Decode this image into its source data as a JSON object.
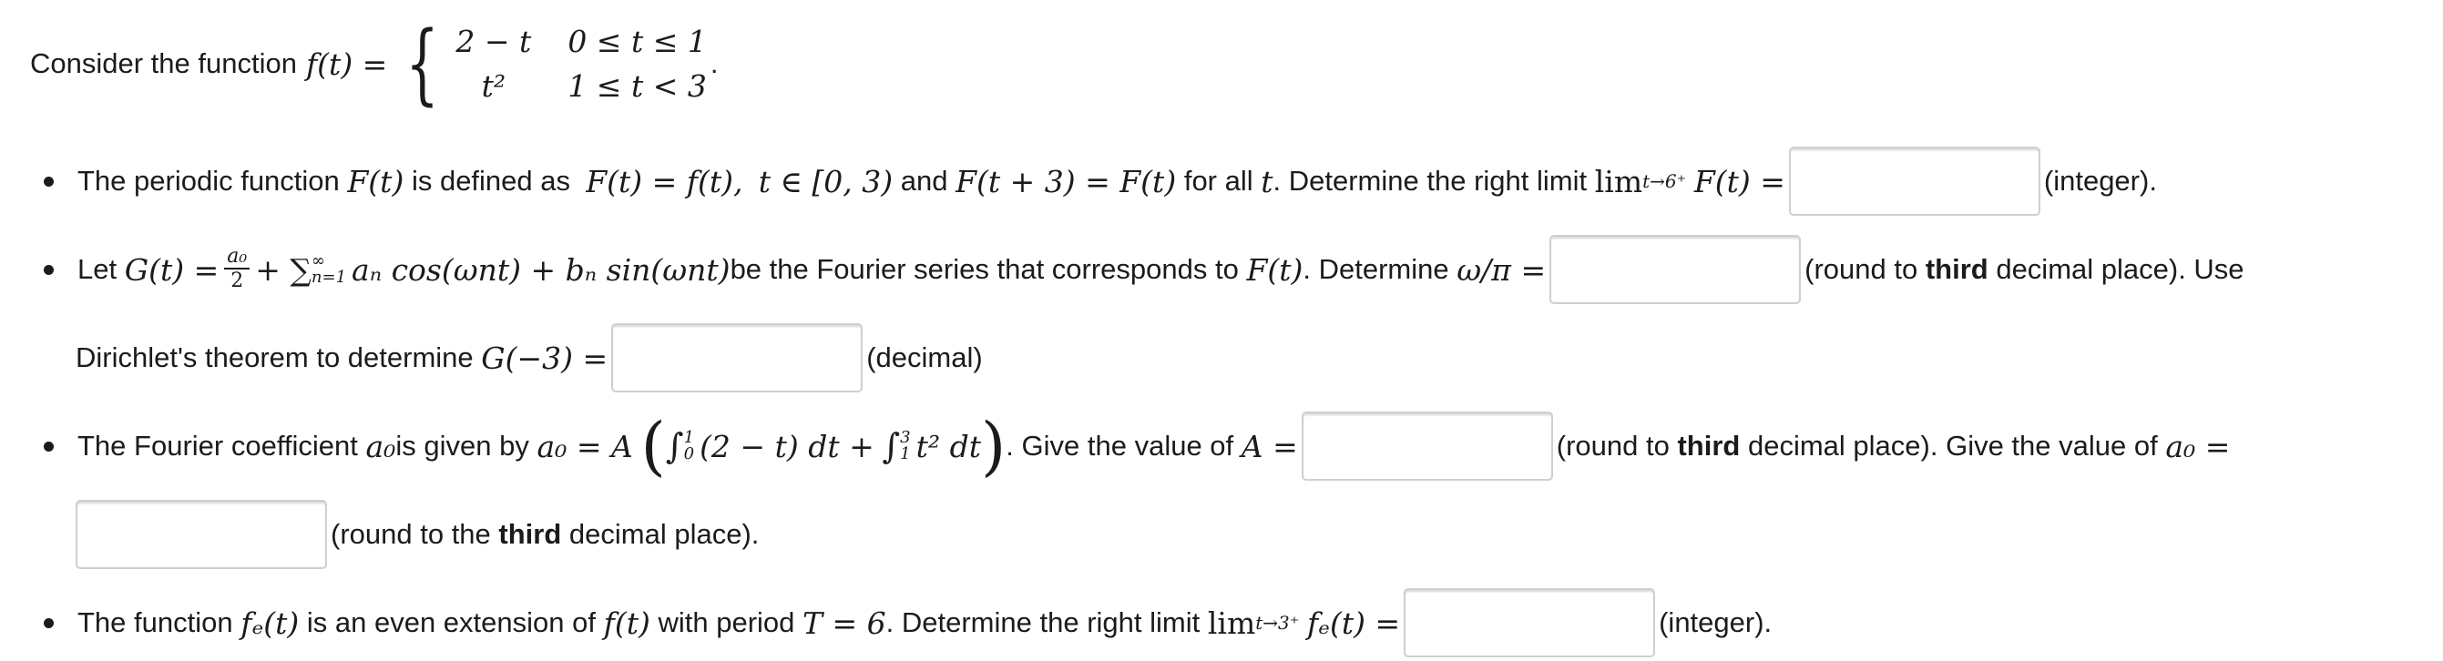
{
  "intro": {
    "text": "Consider the function",
    "func": "f(t) =",
    "cases": [
      {
        "expr": "2 − t",
        "cond": "0 ≤ t ≤ 1"
      },
      {
        "expr": "t²",
        "cond": "1 ≤ t < 3"
      }
    ],
    "end": "."
  },
  "q1": {
    "text1": "The periodic function",
    "Ft": "F(t)",
    "text2": "is defined as",
    "def": "F(t) = f(t),",
    "domain": "t ∈ [0, 3)",
    "text3": "and",
    "periodic": "F(t + 3) = F(t)",
    "text4": "for all",
    "t": "t",
    "text5": ". Determine the right limit",
    "lim": "lim",
    "lim_sub": "t→6⁺",
    "lim_expr": "F(t) =",
    "answer": "",
    "hint": "(integer)."
  },
  "q2": {
    "text1": "Let",
    "G": "G(t) =",
    "num": "a₀",
    "den": "2",
    "sum": "+ ∑",
    "sum_sup": "∞",
    "sum_sub": "n=1",
    "series": "aₙ cos(ωnt) + bₙ sin(ωnt)",
    "text2": "be the Fourier series that corresponds to",
    "Ft": "F(t)",
    "text3": ". Determine",
    "omega": "ω/π =",
    "answer": "",
    "hint_pre": "(round to",
    "hint_bold": "third",
    "hint_post": "decimal place). Use",
    "line2_text": "Dirichlet's theorem to determine",
    "G3": "G(−3) =",
    "answer2": "",
    "hint2": "(decimal)"
  },
  "q3": {
    "text1": "The Fourier coefficient",
    "a0": "a₀",
    "text2": "is given by",
    "eq": "a₀ = A",
    "int1_lims": [
      "1",
      "0"
    ],
    "int1_body": "(2 − t) dt +",
    "int2_lims": [
      "3",
      "1"
    ],
    "int2_body": "t² dt",
    "text3": ". Give the value of",
    "A": "A =",
    "answer": "",
    "hint_pre": "(round to",
    "hint_bold": "third",
    "hint_post": "decimal place). Give the value of",
    "a0_eq": "a₀ =",
    "answer2": "",
    "hint2_pre": "(round to the",
    "hint2_bold": "third",
    "hint2_post": "decimal place)."
  },
  "q4": {
    "text1": "The function",
    "fe": "fₑ(t)",
    "text2": "is an even extension of",
    "ft": "f(t)",
    "text3": "with period",
    "T": "T = 6",
    "text4": ". Determine the right limit",
    "lim": "lim",
    "lim_sub": "t→3⁺",
    "lim_expr": "fₑ(t) =",
    "answer": "",
    "hint": "(integer)."
  }
}
